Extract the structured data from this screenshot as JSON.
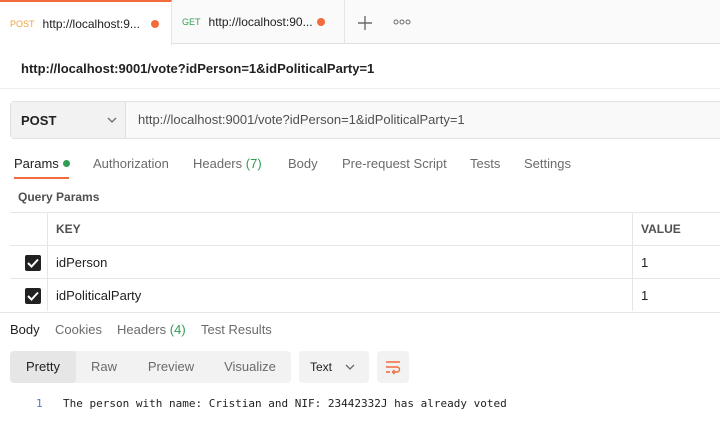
{
  "tabs": [
    {
      "method": "POST",
      "url": "http://localhost:9...",
      "unsaved": true
    },
    {
      "method": "GET",
      "url": "http://localhost:90...",
      "unsaved": true
    }
  ],
  "tab_actions": {
    "new_tab_icon": "plus-icon",
    "more_icon": "more-horizontal-icon"
  },
  "request": {
    "title": "http://localhost:9001/vote?idPerson=1&idPoliticalParty=1",
    "method": "POST",
    "url": "http://localhost:9001/vote?idPerson=1&idPoliticalParty=1"
  },
  "request_tabs": {
    "params": "Params",
    "authorization": "Authorization",
    "headers": "Headers",
    "headers_count": "(7)",
    "body": "Body",
    "pre_request": "Pre-request Script",
    "tests": "Tests",
    "settings": "Settings"
  },
  "query_params": {
    "label": "Query Params",
    "columns": {
      "key": "KEY",
      "value": "VALUE"
    },
    "rows": [
      {
        "key": "idPerson",
        "value": "1",
        "checked": true
      },
      {
        "key": "idPoliticalParty",
        "value": "1",
        "checked": true
      }
    ]
  },
  "response_tabs": {
    "body": "Body",
    "cookies": "Cookies",
    "headers": "Headers",
    "headers_count": "(4)",
    "test_results": "Test Results"
  },
  "response_view": {
    "modes": [
      "Pretty",
      "Raw",
      "Preview",
      "Visualize"
    ],
    "active_mode": "Pretty",
    "format": "Text",
    "wrap_icon": "wrap-lines-icon"
  },
  "response_body": {
    "lines": [
      {
        "number": "1",
        "text": "The person with name: Cristian and NIF: 23442332J has already voted"
      }
    ]
  },
  "colors": {
    "accent": "#f26b3a",
    "post": "#f5a13a",
    "get": "#2f9e53",
    "line_number": "#4a7fb5"
  }
}
